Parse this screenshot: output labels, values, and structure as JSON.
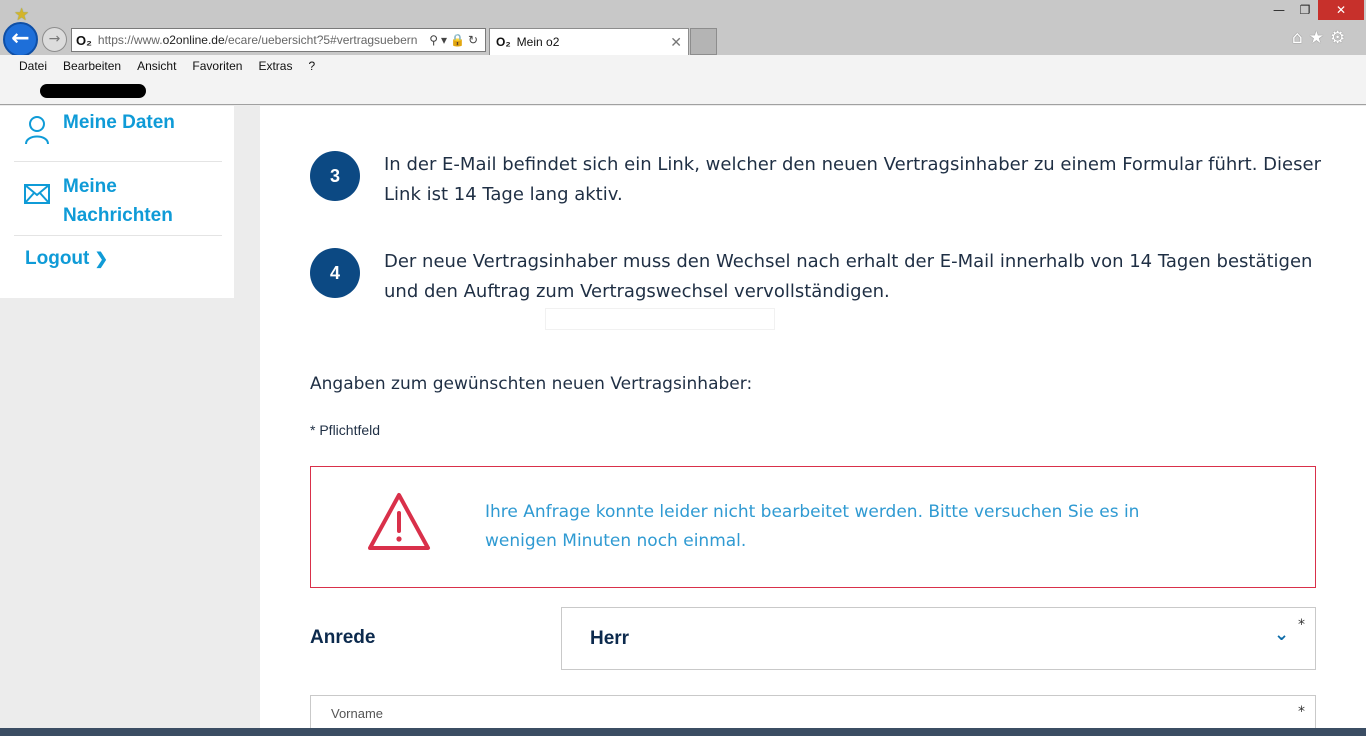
{
  "browser": {
    "brand_mark": "O₂",
    "url_prefix": "https://www.",
    "url_domain": "o2online.de",
    "url_path": "/ecare/uebersicht?5#vertragsuebern",
    "tab_title": "Mein o2",
    "menu": [
      "Datei",
      "Bearbeiten",
      "Ansicht",
      "Favoriten",
      "Extras",
      "?"
    ]
  },
  "sidebar": {
    "items": [
      {
        "label": "Meine Daten",
        "icon": "user-icon"
      },
      {
        "label": "Meine Nachrichten",
        "label_line1": "Meine",
        "label_line2": "Nachrichten",
        "icon": "envelope-icon"
      },
      {
        "label": "Logout",
        "icon": "chevron-right-icon"
      }
    ]
  },
  "steps": [
    {
      "number": "3",
      "line1": "In der E-Mail befindet sich ein Link, welcher den neuen Vertragsinhaber zu einem Formular führt. Dieser",
      "line2": "Link ist 14 Tage lang aktiv."
    },
    {
      "number": "4",
      "line1": "Der neue Vertragsinhaber muss den Wechsel nach erhalt der E-Mail innerhalb von 14 Tagen bestätigen",
      "line2": "und den Auftrag zum Vertragswechsel vervollständigen."
    }
  ],
  "form": {
    "section_title": "Angaben zum gewünschten neuen Vertragsinhaber:",
    "required_note": "* Pflichtfeld",
    "error_line1": "Ihre Anfrage konnte leider nicht bearbeitet werden. Bitte versuchen Sie es in",
    "error_line2": "wenigen Minuten noch einmal.",
    "anrede_label": "Anrede",
    "anrede_value": "Herr",
    "vorname_placeholder": "Vorname",
    "required_mark": "*"
  },
  "colors": {
    "brand_blue": "#0c4983",
    "link_blue": "#0f9bd7",
    "error_red": "#d9304a",
    "error_text": "#2f9ad2"
  }
}
